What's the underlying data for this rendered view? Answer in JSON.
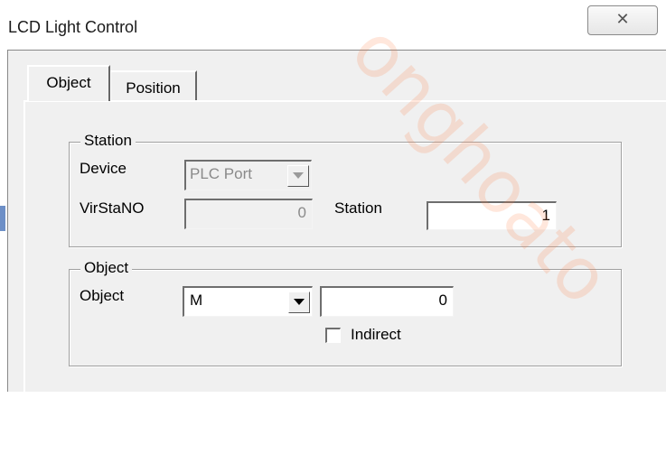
{
  "window": {
    "title": "LCD Light Control",
    "close_label": "✕"
  },
  "tabs": [
    {
      "label": "Object",
      "active": true
    },
    {
      "label": "Position",
      "active": false
    }
  ],
  "station_group": {
    "legend": "Station",
    "device_label": "Device",
    "device_value": "PLC Port",
    "virstano_label": "VirStaNO",
    "virstano_value": "0",
    "station_label": "Station",
    "station_value": "1"
  },
  "object_group": {
    "legend": "Object",
    "object_label": "Object",
    "object_type_value": "M",
    "object_address_value": "0",
    "indirect_label": "Indirect",
    "indirect_checked": false
  },
  "watermark": "onghoato"
}
